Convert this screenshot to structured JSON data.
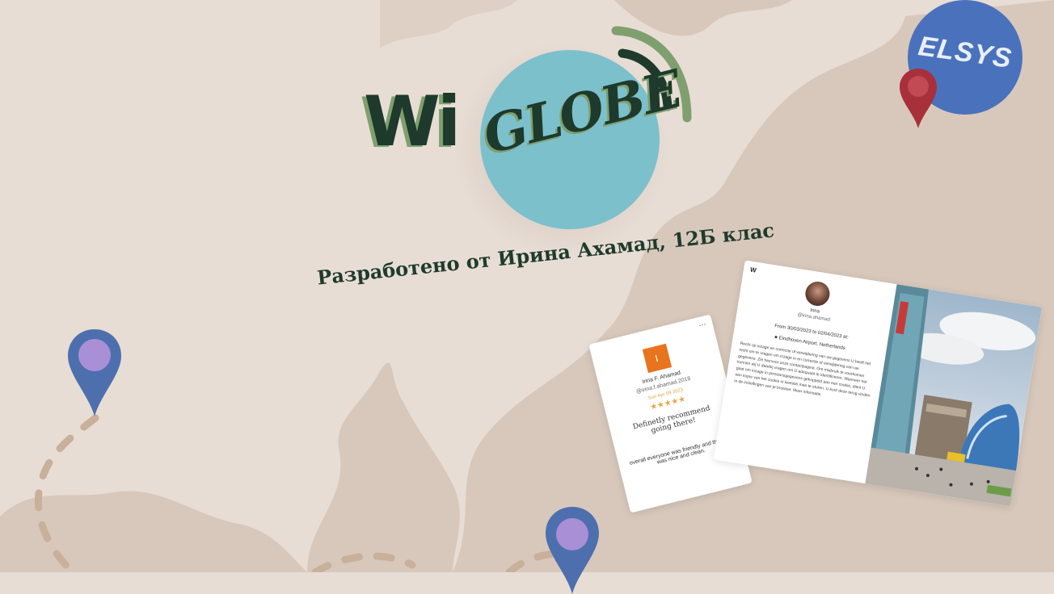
{
  "logo": {
    "wi": "Wi",
    "globe": "GLOBE"
  },
  "credit": "Разработено от Ирина Ахамад, 12Б клас",
  "school_logo": "ELSYS",
  "review_card": {
    "avatar_letter": "I",
    "menu": "...",
    "name": "Irina F. Ahamad",
    "handle": "@irina.f.ahamad.2018",
    "date": "Sun Apr 09 2023",
    "stars": "★★★★★",
    "headline": "Definetly recommend going there!",
    "body": "overall everyone was friendly and the city was nice and clean."
  },
  "post_card": {
    "brand": "W",
    "name": "Irina",
    "handle": "@irina.ahamad",
    "dates": "From 30/03/2023 to 02/04/2023 at:",
    "location": "Eindhoven Airport, Netherlands",
    "text": "Recht op inzage en correctie of verwijdering van uw gegevens U heeft het recht om te vragen om inzage in en correctie of verwijdering van uw gegevens. Zie hiervoor onze contactpagina. Om misbruik te voorkomen kunnen wij U daarbij vragen om U adequaat te identificeren. Wanneer het gaat om inzage in persoonsgegevens gekoppeld aan een cookie, dient U een kopie van het cookie in kwestie mee te sturen. U kunt deze terug vinden in de instellingen van je browser. Meer informatie",
    "pin_icon": "map-pin-icon"
  },
  "colors": {
    "background": "#e8ddd4",
    "map": "#d8c8bb",
    "logo_dark": "#1d3a2c",
    "logo_green": "#7fa06e",
    "globe": "#7cc0cc",
    "pin_blue": "#4e6fae",
    "pin_purple": "#a88fd6",
    "pin_red": "#a8303a",
    "route": "#c9b09b",
    "star": "#e5a54a",
    "avatar": "#e8741e"
  }
}
